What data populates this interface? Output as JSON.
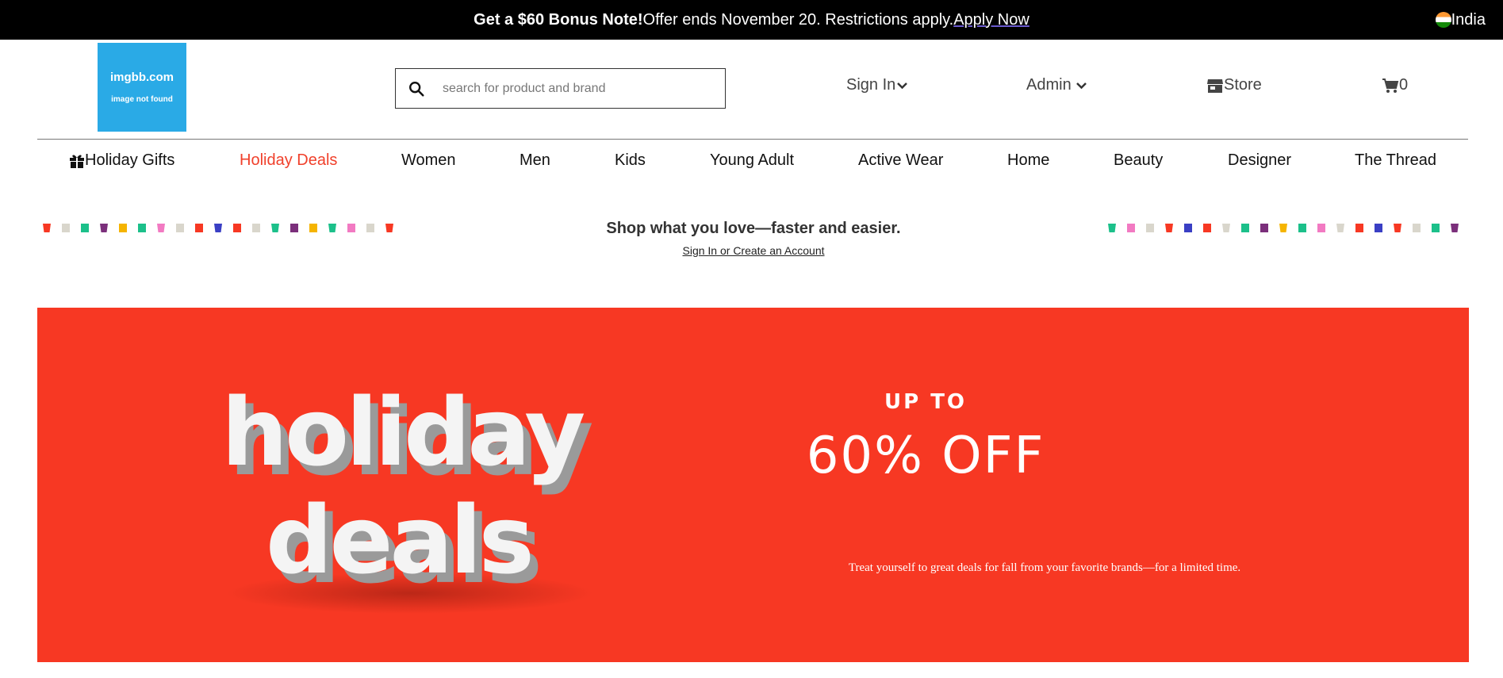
{
  "promo": {
    "bold_text": "Get a $60 Bonus Note!",
    "text": "Offer ends November 20. Restrictions apply.",
    "link": "Apply Now",
    "region": "India"
  },
  "header": {
    "logo_title": "imgbb.com",
    "logo_subtitle": "image not found",
    "search_placeholder": "search for product and brand",
    "sign_in": "Sign In",
    "admin": "Admin",
    "store": "Store",
    "cart_count": "0"
  },
  "nav": {
    "items": [
      {
        "label": "Holiday Gifts"
      },
      {
        "label": "Holiday Deals"
      },
      {
        "label": "Women"
      },
      {
        "label": "Men"
      },
      {
        "label": "Kids"
      },
      {
        "label": "Young Adult"
      },
      {
        "label": "Active Wear"
      },
      {
        "label": "Home"
      },
      {
        "label": "Beauty"
      },
      {
        "label": "Designer"
      },
      {
        "label": "The Thread"
      }
    ],
    "active_color": "#f0402b"
  },
  "signin_strip": {
    "message": "Shop what you love—faster and easier.",
    "link": "Sign In or Create an Account",
    "dot_colors_left": [
      "#f73823",
      "#d9d6cc",
      "#1cc08a",
      "#7b2f7b",
      "#f5b400",
      "#1cc08a",
      "#f27ac2",
      "#d9d6cc",
      "#f73823",
      "#3a3fc4",
      "#f73823",
      "#d9d6cc",
      "#1cc08a",
      "#7b2f7b",
      "#f5b400",
      "#1cc08a",
      "#f27ac2",
      "#d9d6cc",
      "#f73823"
    ],
    "dot_colors_right": [
      "#1cc08a",
      "#f27ac2",
      "#d9d6cc",
      "#f73823",
      "#3a3fc4",
      "#f73823",
      "#d9d6cc",
      "#1cc08a",
      "#7b2f7b",
      "#f5b400",
      "#1cc08a",
      "#f27ac2",
      "#d9d6cc",
      "#f73823",
      "#3a3fc4",
      "#f73823",
      "#d9d6cc",
      "#1cc08a",
      "#7b2f7b"
    ]
  },
  "hero": {
    "bg_color": "#f73823",
    "art_line1": "holiday",
    "art_line2": "deals",
    "up_to": "UP TO",
    "discount": "60% OFF",
    "copy": "Treat yourself to great deals for fall from your favorite brands—for a limited time."
  }
}
